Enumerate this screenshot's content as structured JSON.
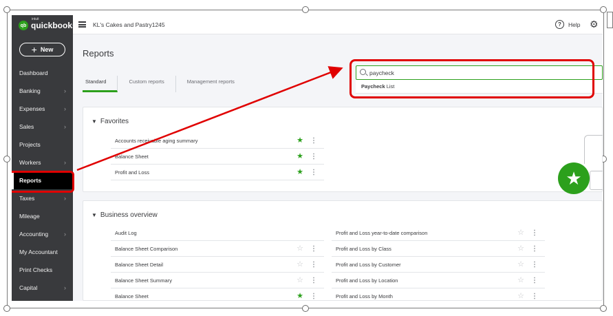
{
  "app": {
    "brand_small": "intuit",
    "brand": "quickbooks",
    "company_name": "KL's Cakes and Pastry1245",
    "help_label": "Help"
  },
  "sidebar": {
    "new_label": "New",
    "items": [
      {
        "label": "Dashboard",
        "chevron": false
      },
      {
        "label": "Banking",
        "chevron": true
      },
      {
        "label": "Expenses",
        "chevron": true
      },
      {
        "label": "Sales",
        "chevron": true
      },
      {
        "label": "Projects",
        "chevron": false
      },
      {
        "label": "Workers",
        "chevron": true
      },
      {
        "label": "Reports",
        "chevron": false,
        "active": true
      },
      {
        "label": "Taxes",
        "chevron": true
      },
      {
        "label": "Mileage",
        "chevron": false
      },
      {
        "label": "Accounting",
        "chevron": true
      },
      {
        "label": "My Accountant",
        "chevron": false
      },
      {
        "label": "Print Checks",
        "chevron": false
      },
      {
        "label": "Capital",
        "chevron": true
      }
    ]
  },
  "main": {
    "title": "Reports",
    "tabs": [
      "Standard",
      "Custom reports",
      "Management reports"
    ],
    "search": {
      "value": "paycheck",
      "suggestion_bold": "Paycheck",
      "suggestion_rest": " List"
    }
  },
  "favorites": {
    "title": "Favorites",
    "rows": [
      {
        "label": "Accounts receivable aging summary",
        "starred": true
      },
      {
        "label": "Balance Sheet",
        "starred": true
      },
      {
        "label": "Profit and Loss",
        "starred": true
      }
    ]
  },
  "business_overview": {
    "title": "Business overview",
    "left": [
      {
        "label": "Audit Log",
        "starred": false,
        "show_actions": false
      },
      {
        "label": "Balance Sheet Comparison",
        "starred": false,
        "show_actions": true
      },
      {
        "label": "Balance Sheet Detail",
        "starred": false,
        "show_actions": true
      },
      {
        "label": "Balance Sheet Summary",
        "starred": false,
        "show_actions": true
      },
      {
        "label": "Balance Sheet",
        "starred": true,
        "show_actions": true
      }
    ],
    "right": [
      {
        "label": "Profit and Loss year-to-date comparison",
        "starred": false,
        "show_actions": true
      },
      {
        "label": "Profit and Loss by Class",
        "starred": false,
        "show_actions": true
      },
      {
        "label": "Profit and Loss by Customer",
        "starred": false,
        "show_actions": true
      },
      {
        "label": "Profit and Loss by Location",
        "starred": false,
        "show_actions": true
      },
      {
        "label": "Profit and Loss by Month",
        "starred": false,
        "show_actions": true
      }
    ]
  },
  "colors": {
    "brand_green": "#2ca01c",
    "sidebar_bg": "#393a3d",
    "annotation_red": "#e00000"
  }
}
